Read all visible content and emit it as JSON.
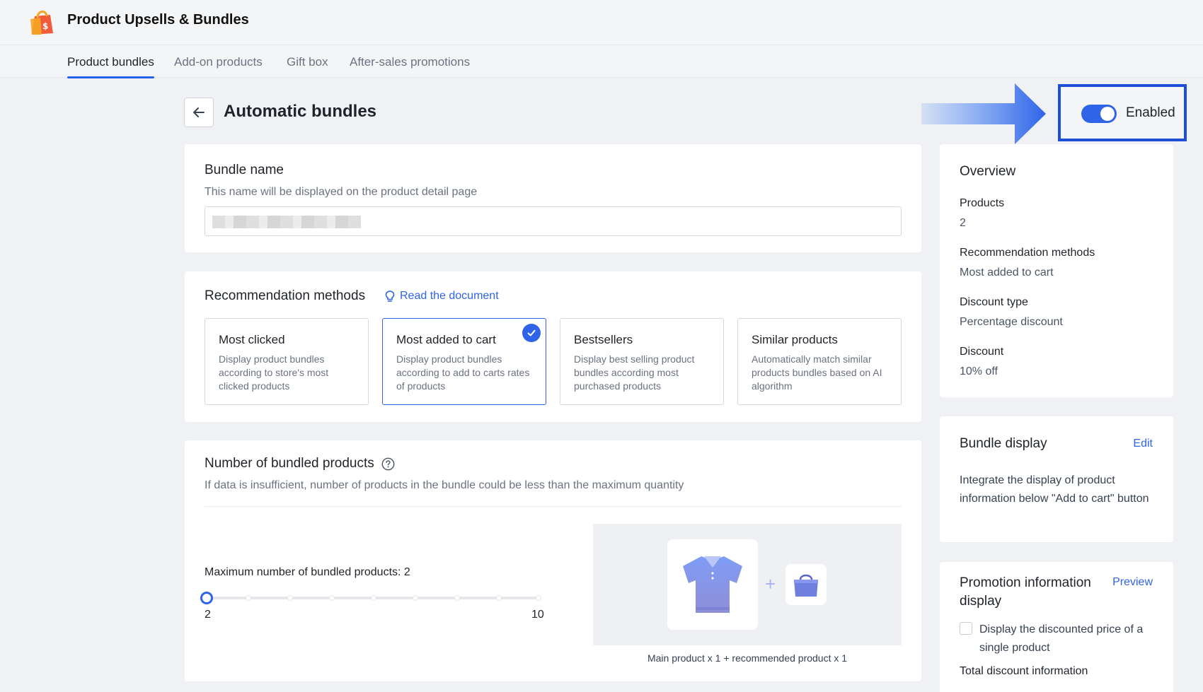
{
  "app": {
    "title": "Product Upsells & Bundles"
  },
  "tabs": [
    {
      "label": "Product bundles"
    },
    {
      "label": "Add-on products"
    },
    {
      "label": "Gift box"
    },
    {
      "label": "After-sales promotions"
    }
  ],
  "page": {
    "title": "Automatic bundles",
    "status_label": "Enabled",
    "enabled": true
  },
  "bundle_name": {
    "heading": "Bundle name",
    "hint": "This name will be displayed on the product detail page"
  },
  "recommendation": {
    "heading": "Recommendation methods",
    "doc_link": "Read the document",
    "methods": [
      {
        "title": "Most clicked",
        "desc": "Display product bundles according to store's most clicked products",
        "selected": false
      },
      {
        "title": "Most added to cart",
        "desc": "Display product bundles according to add to carts rates of products",
        "selected": true
      },
      {
        "title": "Bestsellers",
        "desc": "Display best selling product bundles according most purchased products",
        "selected": false
      },
      {
        "title": "Similar products",
        "desc": "Automatically match similar products bundles based on AI algorithm",
        "selected": false
      }
    ]
  },
  "bundled": {
    "heading": "Number of bundled products",
    "hint": "If data is insufficient, number of products in the bundle could be less than the maximum quantity",
    "max_label": "Maximum number of bundled products: 2",
    "min": "2",
    "max": "10",
    "value": 2,
    "preview_caption": "Main product x 1 + recommended product x 1"
  },
  "overview": {
    "heading": "Overview",
    "items": [
      {
        "label": "Products",
        "value": "2"
      },
      {
        "label": "Recommendation methods",
        "value": "Most added to cart"
      },
      {
        "label": "Discount type",
        "value": "Percentage discount"
      },
      {
        "label": "Discount",
        "value": "10% off"
      }
    ]
  },
  "bundle_display": {
    "heading": "Bundle display",
    "edit_label": "Edit",
    "desc": "Integrate the display of product information below \"Add to cart\" button"
  },
  "promotion": {
    "heading": "Promotion information display",
    "preview_label": "Preview",
    "checkbox_label": "Display the discounted price of a single product",
    "subheading": "Total discount information"
  },
  "colors": {
    "accent": "#2f63e8",
    "highlight_border": "#1d4ed8"
  }
}
